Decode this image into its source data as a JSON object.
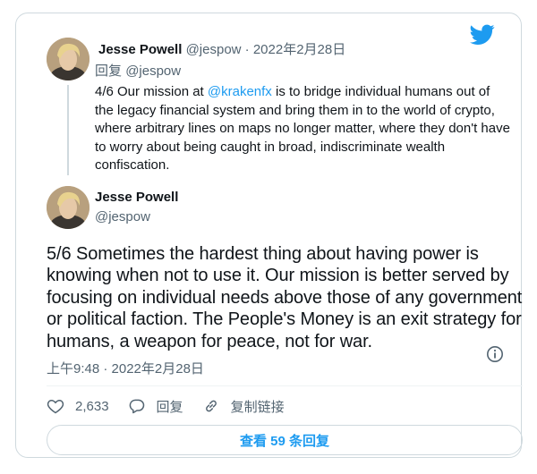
{
  "reply_tweet": {
    "author_name": "Jesse Powell",
    "author_handle": "@jespow",
    "separator": "·",
    "date": "2022年2月28日",
    "reply_label": "回复",
    "reply_to_handle": "@jespow",
    "text_before_mention": "4/6 Our mission at ",
    "mention": "@krakenfx",
    "text_after_mention": " is to bridge individual humans out of the legacy financial system and bring them in to the world of crypto, where arbitrary lines on maps no longer matter, where they don't have to worry about being caught in broad, indiscriminate wealth confiscation."
  },
  "main_tweet": {
    "author_name": "Jesse Powell",
    "author_handle": "@jespow",
    "text": "5/6 Sometimes the hardest thing about having power is knowing when not to use it. Our mission is better served by focusing on individual needs above those of any government or political faction. The People's Money is an exit strategy for humans, a weapon for peace, not for war.",
    "timestamp": "上午9:48 · 2022年2月28日"
  },
  "actions": {
    "like_count": "2,633",
    "reply_label": "回复",
    "copy_link_label": "复制链接"
  },
  "more_replies_label": "查看 59 条回复",
  "icons": {
    "brand": "twitter-bird-icon",
    "info": "info-icon",
    "like": "heart-icon",
    "reply": "speech-bubble-icon",
    "copy_link": "link-icon"
  },
  "colors": {
    "accent": "#1d9bf0",
    "text": "#0f1419",
    "muted": "#536471",
    "border": "#cfd9de"
  }
}
